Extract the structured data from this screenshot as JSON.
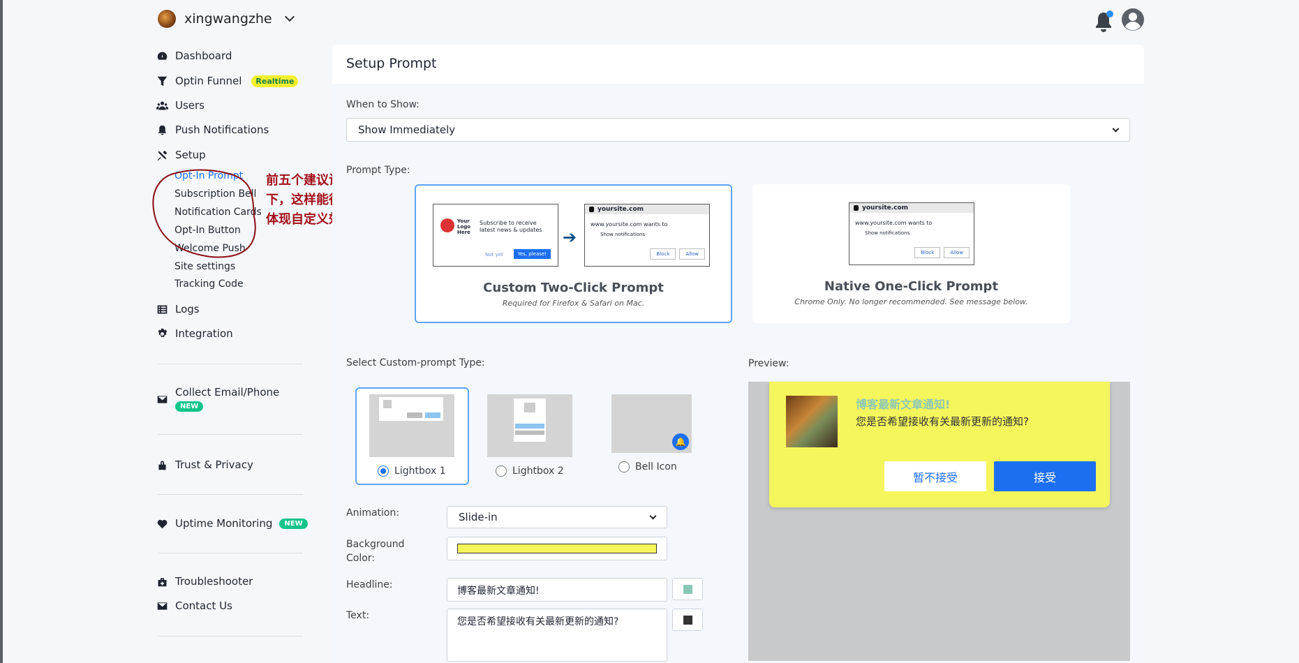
{
  "header": {
    "username": "xingwangzhe"
  },
  "sidebar": {
    "items": [
      {
        "label": "Dashboard"
      },
      {
        "label": "Optin Funnel",
        "badge": "Realtime"
      },
      {
        "label": "Users"
      },
      {
        "label": "Push Notifications"
      },
      {
        "label": "Setup"
      },
      {
        "label": "Logs"
      },
      {
        "label": "Integration"
      }
    ],
    "setup_sub": [
      "Opt-In Prompt",
      "Subscription Bell",
      "Notification Cards",
      "Opt-In Button",
      "Welcome Push",
      "Site settings",
      "Tracking Code"
    ],
    "extra": [
      {
        "label": "Collect Email/Phone",
        "badge": "NEW"
      },
      {
        "label": "Trust & Privacy"
      },
      {
        "label": "Uptime Monitoring",
        "badge": "NEW"
      },
      {
        "label": "Troubleshooter"
      },
      {
        "label": "Contact Us"
      }
    ]
  },
  "annotation": "前五个建议设置一\n下，这样能很好地\n体现自定义效果",
  "main": {
    "title": "Setup Prompt",
    "when_label": "When to Show:",
    "when_value": "Show Immediately",
    "prompt_type_label": "Prompt Type:",
    "custom": {
      "title": "Custom Two-Click Prompt",
      "subtitle": "Required for Firefox & Safari on Mac.",
      "logo_text": "Your Logo Here",
      "subscribe_text": "Subscribe to receive latest news & updates",
      "not_yet": "Not yet",
      "yes": "Yes, please!"
    },
    "native": {
      "title": "Native One-Click Prompt",
      "subtitle": "Chrome Only. No longer recommended. See message below."
    },
    "browser_prompt": {
      "site": "yoursite.com",
      "wants": "www.yoursite.com wants to",
      "show": "Show notifications",
      "block": "Block",
      "allow": "Allow"
    },
    "custom_type_label": "Select Custom-prompt Type:",
    "custom_types": [
      "Lightbox 1",
      "Lightbox 2",
      "Bell Icon"
    ],
    "animation_label": "Animation:",
    "animation_value": "Slide-in",
    "bg_label": "Background Color:",
    "bg_color": "#f5f65c",
    "headline_label": "Headline:",
    "headline_value": "博客最新文章通知!",
    "headline_color": "#8cc7b5",
    "text_label": "Text:",
    "text_value": "您是否希望接收有关最新更新的通知?",
    "text_color": "#333333",
    "preview_label": "Preview:"
  },
  "preview": {
    "headline": "博客最新文章通知!",
    "text": "您是否希望接收有关最新更新的通知?",
    "deny": "暂不接受",
    "accept": "接受"
  },
  "colors": {
    "accent": "#1d6ff2",
    "badge_realtime": "#f3ef2e",
    "badge_new": "#13c48a",
    "annotation": "#a3101a"
  }
}
